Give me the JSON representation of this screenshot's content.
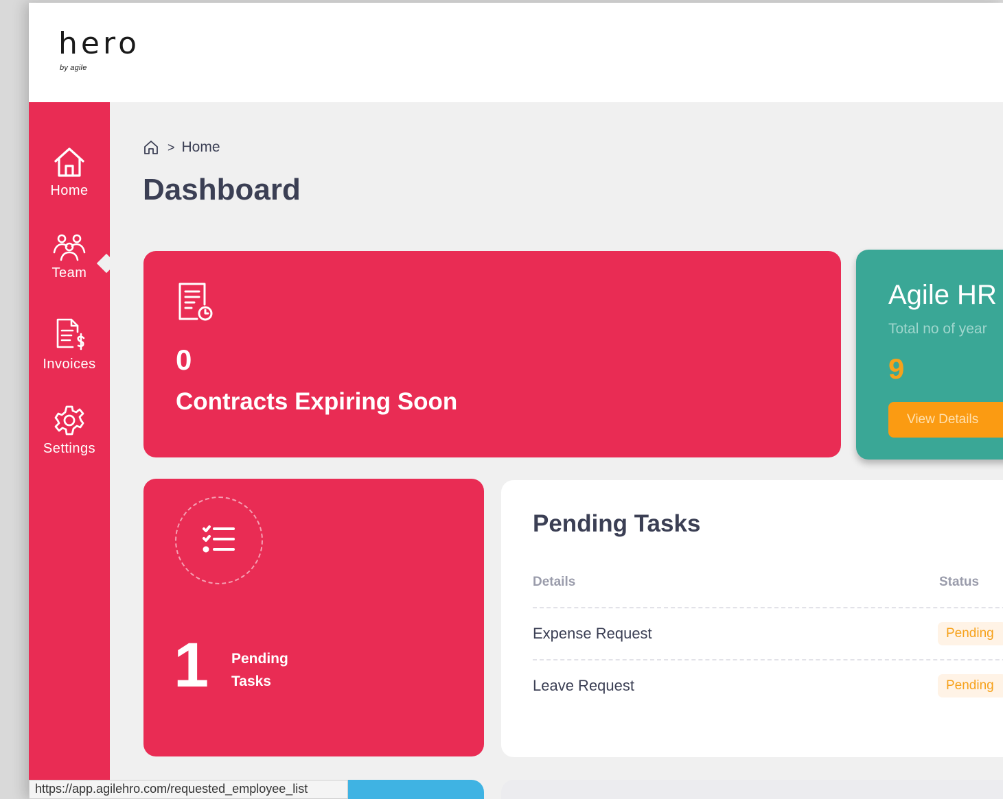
{
  "brand": {
    "name": "hero",
    "tagline": "by agile"
  },
  "sidebar": {
    "items": [
      {
        "label": "Home",
        "icon": "home-icon",
        "active": true
      },
      {
        "label": "Team",
        "icon": "team-icon"
      },
      {
        "label": "Invoices",
        "icon": "invoice-icon"
      },
      {
        "label": "Settings",
        "icon": "gear-icon"
      }
    ]
  },
  "breadcrumb": {
    "separator": ">",
    "current": "Home"
  },
  "page": {
    "title": "Dashboard"
  },
  "contracts": {
    "count": "0",
    "label": "Contracts Expiring Soon"
  },
  "agile": {
    "title": "Agile HR",
    "subtitle": "Total no of year",
    "count": "9",
    "button": "View Details"
  },
  "pending_card": {
    "count": "1",
    "label_line1": "Pending",
    "label_line2": "Tasks"
  },
  "tasks_panel": {
    "title": "Pending Tasks",
    "columns": [
      "Details",
      "Status"
    ],
    "rows": [
      {
        "details": "Expense Request",
        "status": "Pending"
      },
      {
        "details": "Leave Request",
        "status": "Pending"
      }
    ]
  },
  "status_bar": {
    "url": "https://app.agilehro.com/requested_employee_list"
  },
  "colors": {
    "primary": "#e92c54",
    "teal": "#3aa796",
    "orange": "#fb9b12",
    "text": "#3b3f54"
  }
}
